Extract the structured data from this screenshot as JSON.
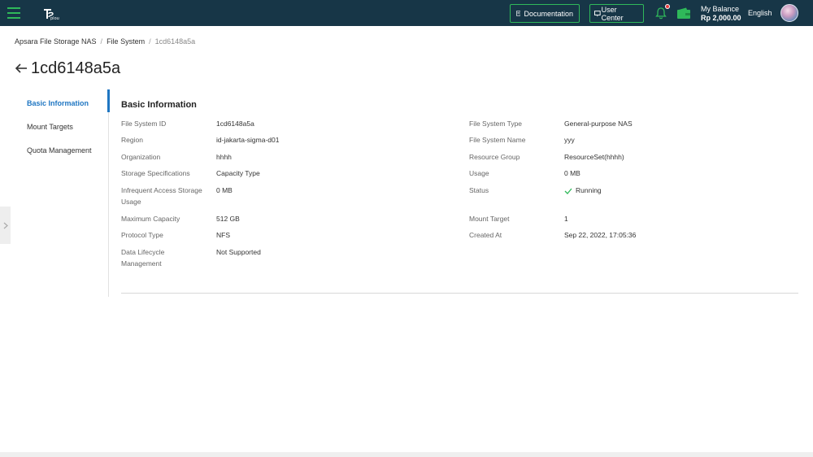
{
  "header": {
    "documentation_label": "Documentation",
    "user_center_label": "User Center",
    "balance_label": "My Balance",
    "balance_value": "Rp 2,000.00",
    "language": "English",
    "accent_color": "#2fb95a",
    "bar_color": "#173647"
  },
  "breadcrumb": {
    "items": [
      "Apsara File Storage NAS",
      "File System",
      "1cd6148a5a"
    ],
    "separator": "/"
  },
  "page": {
    "title": "1cd6148a5a"
  },
  "sidenav": {
    "items": [
      {
        "label": "Basic Information",
        "active": true
      },
      {
        "label": "Mount Targets",
        "active": false
      },
      {
        "label": "Quota Management",
        "active": false
      }
    ]
  },
  "basic_info": {
    "title": "Basic Information",
    "left": [
      {
        "label": "File System ID",
        "value": "1cd6148a5a"
      },
      {
        "label": "Region",
        "value": "id-jakarta-sigma-d01"
      },
      {
        "label": "Organization",
        "value": "hhhh"
      },
      {
        "label": "Storage Specifications",
        "value": "Capacity Type"
      },
      {
        "label": "Infrequent Access Storage Usage",
        "value": "0 MB"
      },
      {
        "label": "Maximum Capacity",
        "value": "512 GB"
      },
      {
        "label": "Protocol Type",
        "value": "NFS"
      },
      {
        "label": "Data Lifecycle Management",
        "value": "Not Supported"
      }
    ],
    "right": [
      {
        "label": "File System Type",
        "value": "General-purpose NAS"
      },
      {
        "label": "File System Name",
        "value": "yyy"
      },
      {
        "label": "Resource Group",
        "value": "ResourceSet(hhhh)"
      },
      {
        "label": "Usage",
        "value": "0 MB"
      },
      {
        "label": "Status",
        "value": "Running"
      },
      {
        "label": "Mount Target",
        "value": "1"
      },
      {
        "label": "Created At",
        "value": "Sep 22, 2022, 17:05:36"
      }
    ],
    "status_color": "#2fb95a"
  }
}
